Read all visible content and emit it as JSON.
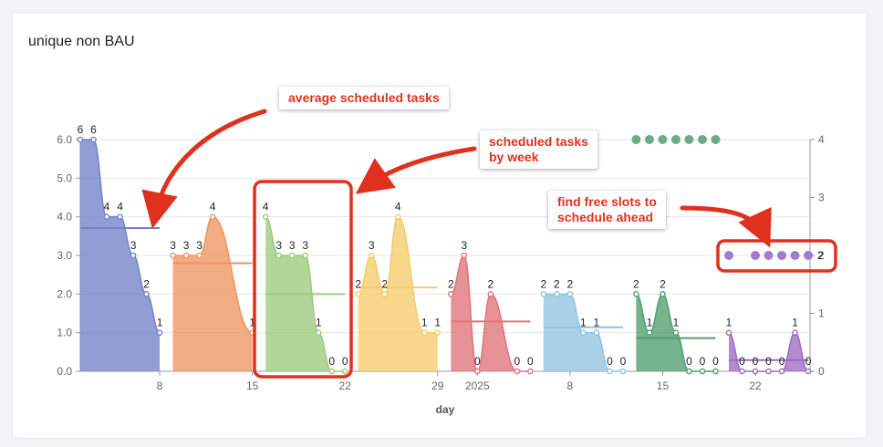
{
  "card": {
    "title": "unique non BAU"
  },
  "annotations": {
    "avg": "average scheduled tasks",
    "weekly": "scheduled tasks\nby week",
    "free": "find free slots to\nschedule ahead"
  },
  "colors": {
    "w1": "#7282c8",
    "w2": "#ee9562",
    "w3": "#9ccb7e",
    "w4": "#f4cc6a",
    "w5": "#e0737a",
    "w6": "#8fc3df",
    "w7": "#4f9e70",
    "w8": "#9b6cc0",
    "green_dots": "#6bab88",
    "purple_dots": "#a27bd0",
    "annotation": "#e0301e"
  },
  "chart_data": {
    "type": "area",
    "xlabel": "day",
    "x_ticks": [
      "8",
      "15",
      "22",
      "29",
      "2025",
      "8",
      "15",
      "22"
    ],
    "ylim": [
      0,
      6
    ],
    "y_ticks": [
      "0.0",
      "1.0",
      "2.0",
      "3.0",
      "4.0",
      "5.0",
      "6.0"
    ],
    "y2lim": [
      0,
      4
    ],
    "y2_ticks": [
      "0",
      "1",
      "2",
      "3",
      "4"
    ],
    "grid": true,
    "series": [
      {
        "points": [
          {
            "day": "2024-12-02",
            "value": 6
          },
          {
            "day": "2024-12-03",
            "value": 6
          },
          {
            "day": "2024-12-04",
            "value": 4
          },
          {
            "day": "2024-12-05",
            "value": 4
          },
          {
            "day": "2024-12-06",
            "value": 3
          },
          {
            "day": "2024-12-07",
            "value": 2
          },
          {
            "day": "2024-12-08",
            "value": 1
          }
        ],
        "average": 3.71
      },
      {
        "points": [
          {
            "day": "2024-12-09",
            "value": 3
          },
          {
            "day": "2024-12-10",
            "value": 3
          },
          {
            "day": "2024-12-11",
            "value": 3
          },
          {
            "day": "2024-12-12",
            "value": 4
          },
          {
            "day": "2024-12-15",
            "value": 1
          }
        ],
        "average": 2.8
      },
      {
        "points": [
          {
            "day": "2024-12-16",
            "value": 4
          },
          {
            "day": "2024-12-17",
            "value": 3
          },
          {
            "day": "2024-12-18",
            "value": 3
          },
          {
            "day": "2024-12-19",
            "value": 3
          },
          {
            "day": "2024-12-20",
            "value": 1
          },
          {
            "day": "2024-12-21",
            "value": 0
          },
          {
            "day": "2024-12-22",
            "value": 0
          }
        ],
        "average": 2
      },
      {
        "points": [
          {
            "day": "2024-12-23",
            "value": 2
          },
          {
            "day": "2024-12-24",
            "value": 3
          },
          {
            "day": "2024-12-25",
            "value": 2
          },
          {
            "day": "2024-12-26",
            "value": 4
          },
          {
            "day": "2024-12-28",
            "value": 1
          },
          {
            "day": "2024-12-29",
            "value": 1
          }
        ],
        "average": 2.17
      },
      {
        "points": [
          {
            "day": "2024-12-30",
            "value": 2
          },
          {
            "day": "2024-12-31",
            "value": 3
          },
          {
            "day": "2025-01-01",
            "value": 0
          },
          {
            "day": "2025-01-02",
            "value": 2
          },
          {
            "day": "2025-01-04",
            "value": 0
          },
          {
            "day": "2025-01-05",
            "value": 0
          }
        ],
        "average": 1.29
      },
      {
        "points": [
          {
            "day": "2025-01-06",
            "value": 2
          },
          {
            "day": "2025-01-07",
            "value": 2
          },
          {
            "day": "2025-01-08",
            "value": 2
          },
          {
            "day": "2025-01-09",
            "value": 1
          },
          {
            "day": "2025-01-10",
            "value": 1
          },
          {
            "day": "2025-01-11",
            "value": 0
          },
          {
            "day": "2025-01-12",
            "value": 0
          }
        ],
        "average": 1.14
      },
      {
        "points": [
          {
            "day": "2025-01-13",
            "value": 2
          },
          {
            "day": "2025-01-14",
            "value": 1
          },
          {
            "day": "2025-01-15",
            "value": 2
          },
          {
            "day": "2025-01-16",
            "value": 1
          },
          {
            "day": "2025-01-17",
            "value": 0
          },
          {
            "day": "2025-01-18",
            "value": 0
          },
          {
            "day": "2025-01-19",
            "value": 0
          }
        ],
        "average": 0.86
      },
      {
        "points": [
          {
            "day": "2025-01-20",
            "value": 1
          },
          {
            "day": "2025-01-21",
            "value": 0
          },
          {
            "day": "2025-01-22",
            "value": 0
          },
          {
            "day": "2025-01-23",
            "value": 0
          },
          {
            "day": "2025-01-24",
            "value": 0
          },
          {
            "day": "2025-01-25",
            "value": 1
          },
          {
            "day": "2025-01-26",
            "value": 0
          }
        ],
        "average": 0.29
      }
    ],
    "free_slot_series": {
      "green": {
        "axis": "right",
        "value": 4,
        "days": [
          "2025-01-13",
          "2025-01-14",
          "2025-01-15",
          "2025-01-16",
          "2025-01-17",
          "2025-01-18",
          "2025-01-19"
        ]
      },
      "purple": {
        "axis": "right",
        "value": 2,
        "days": [
          "2025-01-20",
          "2025-01-22",
          "2025-01-23",
          "2025-01-24",
          "2025-01-25",
          "2025-01-26"
        ],
        "label": "2"
      }
    }
  }
}
